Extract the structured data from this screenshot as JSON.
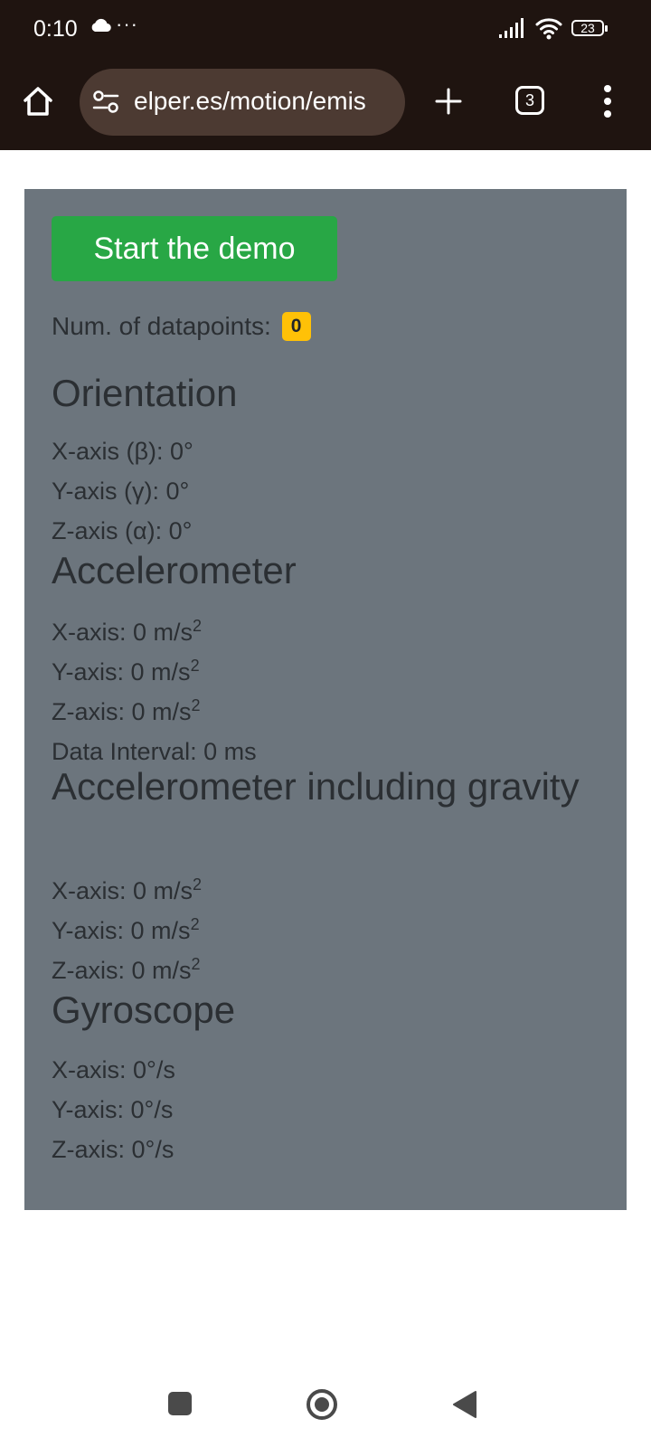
{
  "status_bar": {
    "time": "0:10",
    "dots": "···",
    "battery": "23",
    "cloud_icon": "cloud-icon",
    "signal_icon": "cellular-signal-icon",
    "wifi_icon": "wifi-icon",
    "battery_icon": "battery-icon"
  },
  "browser": {
    "url": "elper.es/motion/emis",
    "tab_count": "3",
    "home_icon": "home-icon",
    "site_settings_icon": "site-settings-icon",
    "new_tab_icon": "plus-icon",
    "menu_icon": "more-vertical-icon"
  },
  "demo": {
    "start_button_label": "Start the demo",
    "datapoints_label": "Num. of datapoints:",
    "datapoints_count": "0",
    "orientation": {
      "title": "Orientation",
      "x": "X-axis (β): 0°",
      "y": "Y-axis (γ): 0°",
      "z": "Z-axis (α): 0°"
    },
    "accelerometer": {
      "title": "Accelerometer",
      "x": "X-axis: 0 m/s",
      "y": "Y-axis: 0 m/s",
      "z": "Z-axis: 0 m/s",
      "unit_exponent": "2",
      "interval": "Data Interval: 0 ms"
    },
    "accelerometer_gravity": {
      "title": "Accelerometer including gravity",
      "x": "X-axis: 0 m/s",
      "y": "Y-axis: 0 m/s",
      "z": "Z-axis: 0 m/s",
      "unit_exponent": "2"
    },
    "gyroscope": {
      "title": "Gyroscope",
      "x": "X-axis: 0°/s",
      "y": "Y-axis: 0°/s",
      "z": "Z-axis: 0°/s"
    }
  },
  "nav_bar": {
    "recents_icon": "recents-square-icon",
    "home_icon": "home-circle-icon",
    "back_icon": "back-triangle-icon"
  },
  "colors": {
    "browser_bar": "#1f1410",
    "url_pill": "#4c3a32",
    "panel": "#6c757d",
    "start_button": "#28a745",
    "badge": "#ffc107",
    "text": "#2b2f33"
  }
}
